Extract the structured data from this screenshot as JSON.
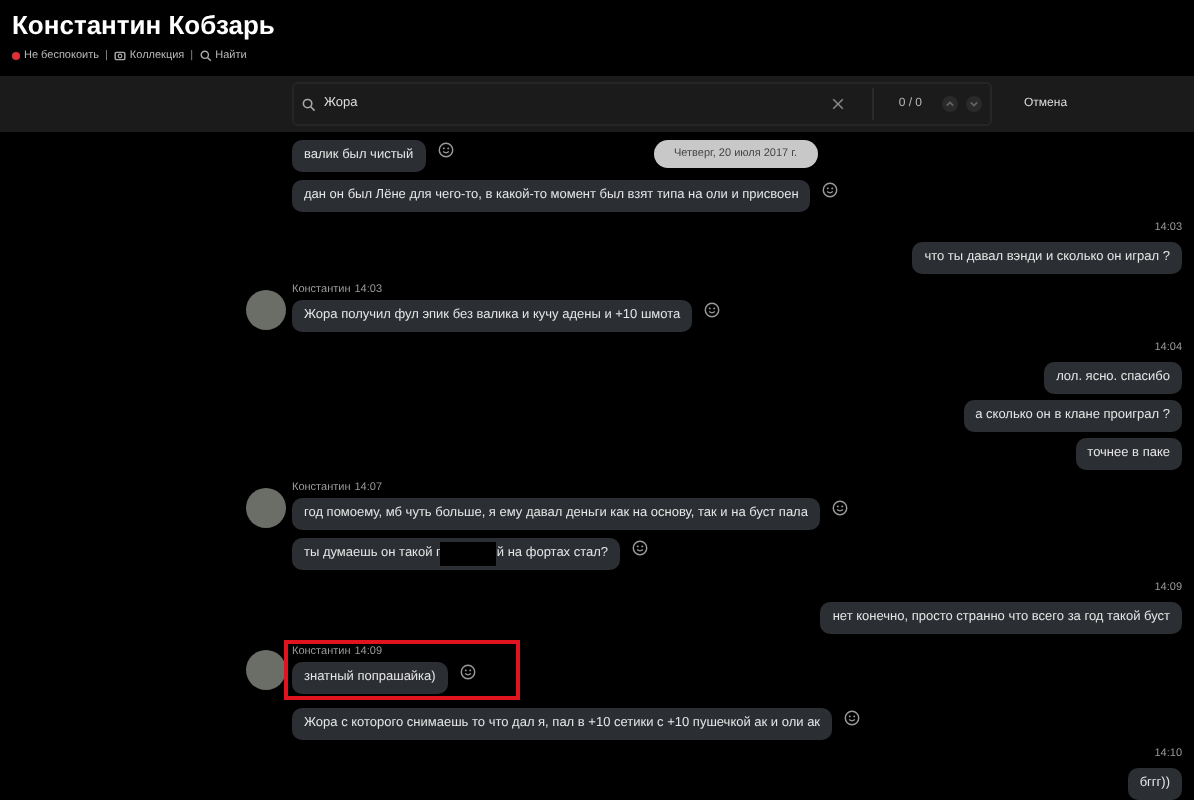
{
  "header": {
    "title": "Константин Кобзарь",
    "separator": "|",
    "status_items": [
      {
        "kind": "status",
        "label": "Не беспокоить",
        "color": "#e0303a"
      },
      {
        "kind": "collection",
        "label": "Коллекция"
      },
      {
        "kind": "find",
        "label": "Найти"
      }
    ]
  },
  "search": {
    "value": "Жора",
    "counter": "0 / 0",
    "cancel": "Отмена"
  },
  "date_pill": "Четверг, 20 июля 2017 г.",
  "messages": [
    {
      "kind": "incoming",
      "highlighted": false,
      "bubbles": [
        {
          "text": "валик был чистый"
        },
        {
          "text": "дан он был Лёне для чего-то, в какой-то момент был взят типа на оли и присвоен"
        }
      ]
    },
    {
      "kind": "outgoing",
      "time": "14:03",
      "bubbles": [
        {
          "text": "что ты давал вэнди и сколько он играл ?"
        }
      ]
    },
    {
      "kind": "incoming",
      "sender": "Константин",
      "time": "14:03",
      "highlighted": false,
      "bubbles": [
        {
          "text": "Жора получил фул эпик без валика и кучу адены и  +10 шмота"
        }
      ]
    },
    {
      "kind": "outgoing",
      "time": "14:04",
      "bubbles": [
        {
          "text": "лол. ясно. спасибо"
        },
        {
          "text": "а сколько он в клане проиграл ?"
        },
        {
          "text": "точнее в паке"
        }
      ]
    },
    {
      "kind": "incoming",
      "sender": "Константин",
      "time": "14:07",
      "highlighted": false,
      "bubbles": [
        {
          "text": "год помоему, мб чуть больше, я ему давал деньги как на основу, так и на буст пала"
        },
        {
          "text": "ты думаешь он такой г",
          "text_after": "й на фортах стал?"
        }
      ]
    },
    {
      "kind": "outgoing",
      "time": "14:09",
      "bubbles": [
        {
          "text": "нет конечно, просто странно что всего за год такой буст"
        }
      ]
    },
    {
      "kind": "incoming",
      "sender": "Константин",
      "time": "14:09",
      "highlighted": true,
      "bubbles": [
        {
          "text": "знатный попрашайка)"
        },
        {
          "text": "Жора с которого снимаешь то что дал я, пал в +10 сетики с +10 пушечкой ак и оли ак"
        }
      ]
    },
    {
      "kind": "outgoing",
      "time": "14:10",
      "bubbles": [
        {
          "text": "бггг))"
        }
      ]
    }
  ]
}
